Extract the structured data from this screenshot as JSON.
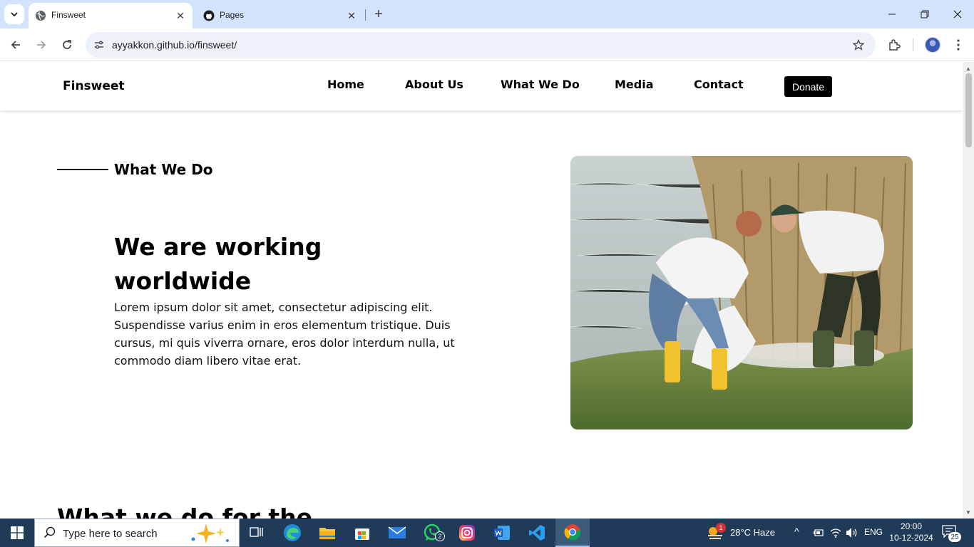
{
  "browser": {
    "tabs": [
      {
        "title": "Finsweet",
        "active": true,
        "icon": "globe-icon"
      },
      {
        "title": "Pages",
        "active": false,
        "icon": "github-icon"
      }
    ],
    "url": "ayyakkon.github.io/finsweet/"
  },
  "site": {
    "brand": "Finsweet",
    "nav": [
      "Home",
      "About Us",
      "What We Do",
      "Media",
      "Contact"
    ],
    "donate_label": "Donate"
  },
  "hero": {
    "eyebrow": "What We Do",
    "headline_line1": "We are working",
    "headline_line2": "worldwide",
    "body": "Lorem ipsum dolor sit amet, consectetur adipiscing elit. Suspendisse varius enim in eros elementum tristique. Duis cursus, mi quis viverra ornare, eros dolor interdum nulla, ut commodo diam libero vitae erat.",
    "image": "volunteers-collecting-litter-by-lake-photo"
  },
  "section2_title": "What we do for the",
  "taskbar": {
    "search_placeholder": "Type here to search",
    "apps": [
      "task-view-icon",
      "edge-icon",
      "file-explorer-icon",
      "store-icon",
      "mail-icon",
      "whatsapp-icon",
      "instagram-icon",
      "word-icon",
      "vscode-icon",
      "chrome-icon"
    ],
    "whatsapp_badge": "2",
    "weather_badge": "1",
    "weather": "28°C  Haze",
    "language": "ENG",
    "time": "20:00",
    "date": "10-12-2024",
    "notifications": "25"
  }
}
